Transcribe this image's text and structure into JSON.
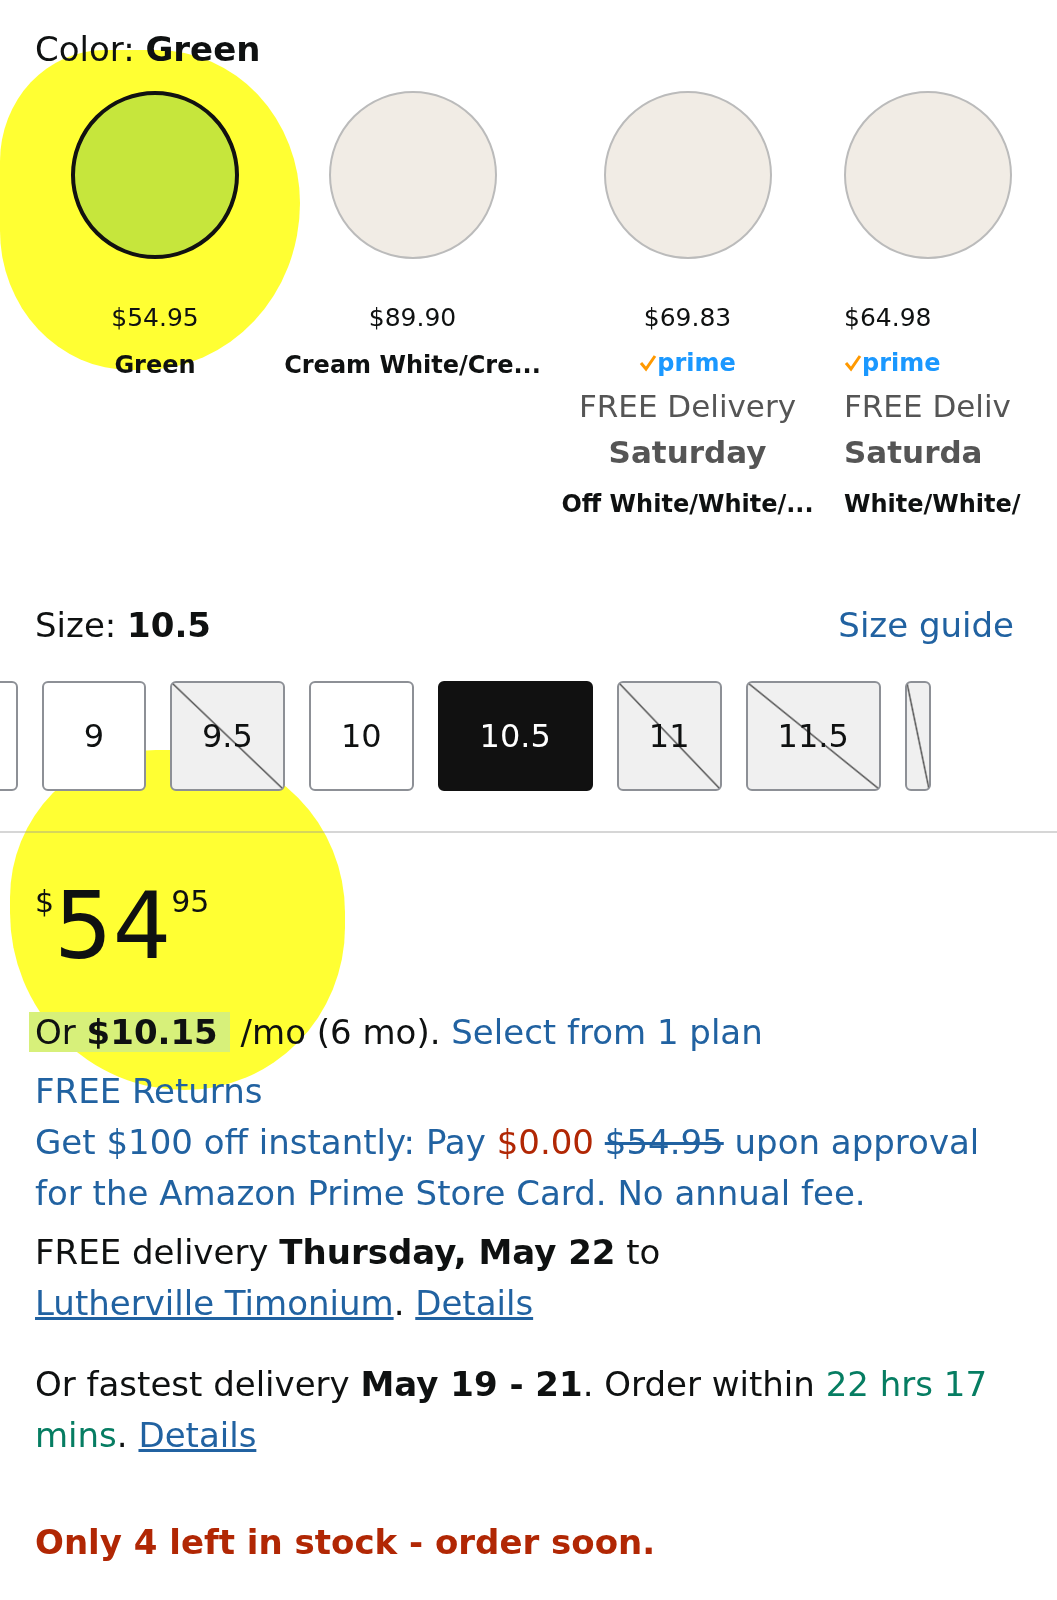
{
  "color_selector": {
    "label": "Color:",
    "value": "Green",
    "swatches": [
      {
        "price": "$54.95",
        "name": "Green",
        "selected": true,
        "highlighted": true
      },
      {
        "price": "$89.90",
        "name": "Cream White/Cre...",
        "selected": false,
        "highlighted": false
      },
      {
        "price": "$69.83",
        "prime_badge": "prime",
        "delivery_note": "FREE Delivery",
        "delivery_day": "Saturday",
        "name": "Off White/White/...",
        "selected": false,
        "highlighted": false
      },
      {
        "price": "$64.98",
        "prime_badge": "prime",
        "delivery_note": "FREE Deliv",
        "delivery_day": "Saturda",
        "name": "White/White/",
        "selected": false,
        "highlighted": false
      }
    ]
  },
  "size_selector": {
    "label": "Size:",
    "value": "10.5",
    "guide_link": "Size guide",
    "sizes": [
      {
        "available": true,
        "selected": false
      },
      {
        "label": "9",
        "available": true,
        "selected": false
      },
      {
        "label": "9.5",
        "available": false,
        "selected": false
      },
      {
        "label": "10",
        "available": true,
        "selected": false
      },
      {
        "label": "10.5",
        "available": true,
        "selected": true
      },
      {
        "label": "11",
        "available": false,
        "selected": false
      },
      {
        "label": "11.5",
        "available": false,
        "selected": false
      },
      {
        "available": false,
        "selected": false
      }
    ]
  },
  "price": {
    "currency": "$",
    "whole": "54",
    "fraction": "95",
    "highlighted": true
  },
  "installment": {
    "text": "Or **$10.15**",
    "rest": "/mo (6 mo).",
    "link": "Select from 1 plan"
  },
  "returns_link": "FREE Returns",
  "card_offer": [
    {
      "kind": "text",
      "text": "Get $100 off instantly: Pay "
    },
    {
      "kind": "sale",
      "text": "$0.00 "
    },
    {
      "kind": "struck",
      "text": "$54.95"
    },
    {
      "kind": "text",
      "text": " upon approval for the Amazon Prime Store Card. No annual fee."
    }
  ],
  "delivery": [
    {
      "kind": "text",
      "text": "FREE delivery **Thursday, May 22** to "
    },
    {
      "kind": "link",
      "text": "Lutherville Timonium"
    },
    {
      "kind": "text",
      "text": ". "
    },
    {
      "kind": "link",
      "text": "Details"
    }
  ],
  "fastest_delivery": [
    {
      "kind": "text",
      "text": "Or fastest delivery **May 19 - 21**. Order within "
    },
    {
      "kind": "countdown",
      "text": "22 hrs 17 mins"
    },
    {
      "kind": "text",
      "text": ". "
    },
    {
      "kind": "link",
      "text": "Details"
    }
  ],
  "stock_notice": "Only 4 left in stock - order soon."
}
